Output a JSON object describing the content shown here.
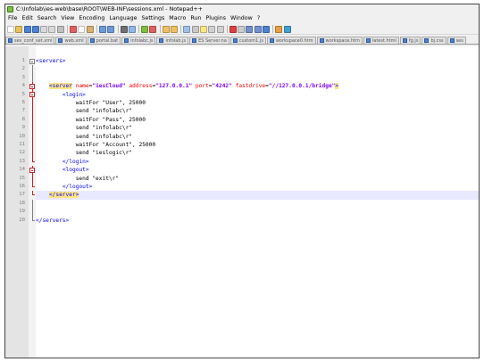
{
  "window": {
    "title": "C:\\Infolab\\ies-web\\base\\ROOT\\WEB-INF\\sessions.xml - Notepad++"
  },
  "menu": [
    "File",
    "Edit",
    "Search",
    "View",
    "Encoding",
    "Language",
    "Settings",
    "Macro",
    "Run",
    "Plugins",
    "Window",
    "?"
  ],
  "toolbar": {
    "buttons": [
      {
        "name": "new-file-icon",
        "color": "#ffffff"
      },
      {
        "name": "open-file-icon",
        "color": "#e8c25a"
      },
      {
        "name": "save-icon",
        "color": "#4a82d4"
      },
      {
        "name": "save-all-icon",
        "color": "#4a82d4"
      },
      {
        "name": "close-icon",
        "color": "#d9d9d9"
      },
      {
        "name": "close-all-icon",
        "color": "#d9d9d9"
      },
      {
        "name": "print-icon",
        "color": "#bfbfbf"
      },
      {
        "sep": true
      },
      {
        "name": "cut-icon",
        "color": "#e06060"
      },
      {
        "name": "copy-icon",
        "color": "#ffffff"
      },
      {
        "name": "paste-icon",
        "color": "#d8b070"
      },
      {
        "sep": true
      },
      {
        "name": "undo-icon",
        "color": "#6a9ad8"
      },
      {
        "name": "redo-icon",
        "color": "#6a9ad8"
      },
      {
        "sep": true
      },
      {
        "name": "find-icon",
        "color": "#707070"
      },
      {
        "name": "replace-icon",
        "color": "#8fb7e8"
      },
      {
        "sep": true
      },
      {
        "name": "zoom-in-icon",
        "color": "#7fbf3f"
      },
      {
        "name": "zoom-out-icon",
        "color": "#e06060"
      },
      {
        "sep": true
      },
      {
        "name": "sync-vertical-icon",
        "color": "#f0c060"
      },
      {
        "name": "sync-horizontal-icon",
        "color": "#f0c060"
      },
      {
        "sep": true
      },
      {
        "name": "word-wrap-icon",
        "color": "#9fc0e8"
      },
      {
        "name": "show-all-chars-icon",
        "color": "#c8c8c8"
      },
      {
        "name": "indent-guide-icon",
        "color": "#ffe680"
      },
      {
        "name": "doc-map-icon",
        "color": "#d0d0d0"
      },
      {
        "name": "function-list-icon",
        "color": "#d0d0d0"
      },
      {
        "sep": true
      },
      {
        "name": "record-macro-icon",
        "color": "#e04040"
      },
      {
        "name": "stop-record-icon",
        "color": "#cccccc"
      },
      {
        "name": "playback-icon",
        "color": "#7090d0"
      },
      {
        "name": "run-multiple-icon",
        "color": "#7090d0"
      },
      {
        "name": "save-macro-icon",
        "color": "#4a82d4"
      },
      {
        "sep": true
      },
      {
        "name": "spell-check-icon",
        "color": "#e8a040"
      },
      {
        "name": "plugin-icon",
        "color": "#40a0d0"
      }
    ]
  },
  "tabs": [
    "ses_conf_set.xml",
    "web.xml",
    "portal.bat",
    "infolabc.js",
    "infolab.js",
    "ES Server.na",
    "custom1.js",
    "workspace0.htm",
    "workspace.htm",
    "latest.html",
    "fg.js",
    "bj.css",
    "ses"
  ],
  "editor": {
    "line_numbers": [
      "1",
      "2",
      "3",
      "4",
      "5",
      "6",
      "7",
      "8",
      "9",
      "10",
      "11",
      "12",
      "13",
      "14",
      "15",
      "16",
      "17",
      "18",
      "19",
      "20"
    ],
    "lines": [
      {
        "segments": [
          {
            "t": "<servers>",
            "c": "tag"
          }
        ]
      },
      {
        "segments": []
      },
      {
        "segments": []
      },
      {
        "segments": [
          {
            "t": "    "
          },
          {
            "t": "<server",
            "c": "tag hl"
          },
          {
            "t": " ",
            "c": "plain"
          },
          {
            "t": "name",
            "c": "attr"
          },
          {
            "t": "=",
            "c": "plain"
          },
          {
            "t": "\"iesCloud\"",
            "c": "val"
          },
          {
            "t": " ",
            "c": "plain"
          },
          {
            "t": "address",
            "c": "attr"
          },
          {
            "t": "=",
            "c": "plain"
          },
          {
            "t": "\"127.0.0.1\"",
            "c": "val"
          },
          {
            "t": " ",
            "c": "plain"
          },
          {
            "t": "port",
            "c": "attr"
          },
          {
            "t": "=",
            "c": "plain"
          },
          {
            "t": "\"4242\"",
            "c": "val"
          },
          {
            "t": " ",
            "c": "plain"
          },
          {
            "t": "fastdrive",
            "c": "attr"
          },
          {
            "t": "=",
            "c": "plain"
          },
          {
            "t": "\"//127.0.0.1/bridge\"",
            "c": "val"
          },
          {
            "t": ">",
            "c": "tag hl"
          }
        ]
      },
      {
        "segments": [
          {
            "t": "        "
          },
          {
            "t": "<login>",
            "c": "tag"
          }
        ]
      },
      {
        "segments": [
          {
            "t": "            waitFor \"User\", 25000",
            "c": "plain"
          }
        ]
      },
      {
        "segments": [
          {
            "t": "            send \"infolabc\\r\"",
            "c": "plain"
          }
        ]
      },
      {
        "segments": [
          {
            "t": "            waitFor \"Pass\", 25000",
            "c": "plain"
          }
        ]
      },
      {
        "segments": [
          {
            "t": "            send \"infolabc\\r\"",
            "c": "plain"
          }
        ]
      },
      {
        "segments": [
          {
            "t": "            send \"infolabc\\r\"",
            "c": "plain"
          }
        ]
      },
      {
        "segments": [
          {
            "t": "            waitFor \"Account\", 25000",
            "c": "plain"
          }
        ]
      },
      {
        "segments": [
          {
            "t": "            send \"ieslogic\\r\"",
            "c": "plain"
          }
        ]
      },
      {
        "segments": [
          {
            "t": "        "
          },
          {
            "t": "</login>",
            "c": "tag"
          }
        ]
      },
      {
        "segments": [
          {
            "t": "        "
          },
          {
            "t": "<logout>",
            "c": "tag"
          }
        ]
      },
      {
        "segments": [
          {
            "t": "            send \"exit\\r\"",
            "c": "plain"
          }
        ]
      },
      {
        "segments": [
          {
            "t": "        "
          },
          {
            "t": "</logout>",
            "c": "tag"
          }
        ]
      },
      {
        "segments": [
          {
            "t": "    "
          },
          {
            "t": "</server>",
            "c": "tag hl"
          }
        ],
        "current": true
      },
      {
        "segments": []
      },
      {
        "segments": []
      },
      {
        "segments": [
          {
            "t": "</servers>",
            "c": "tag"
          }
        ]
      }
    ],
    "folds": [
      {
        "line": 1,
        "kind": "box"
      },
      {
        "line": 2,
        "kind": "vline"
      },
      {
        "line": 3,
        "kind": "vline"
      },
      {
        "line": 4,
        "kind": "box",
        "red": true
      },
      {
        "line": 5,
        "kind": "box",
        "red": true
      },
      {
        "line": 6,
        "kind": "vline",
        "red": true
      },
      {
        "line": 7,
        "kind": "vline",
        "red": true
      },
      {
        "line": 8,
        "kind": "vline",
        "red": true
      },
      {
        "line": 9,
        "kind": "vline",
        "red": true
      },
      {
        "line": 10,
        "kind": "vline",
        "red": true
      },
      {
        "line": 11,
        "kind": "vline",
        "red": true
      },
      {
        "line": 12,
        "kind": "vline",
        "red": true
      },
      {
        "line": 13,
        "kind": "end",
        "red": true
      },
      {
        "line": 14,
        "kind": "box",
        "red": true
      },
      {
        "line": 15,
        "kind": "vline",
        "red": true
      },
      {
        "line": 16,
        "kind": "end",
        "red": true
      },
      {
        "line": 17,
        "kind": "end",
        "red": true
      },
      {
        "line": 18,
        "kind": "vline"
      },
      {
        "line": 19,
        "kind": "vline"
      },
      {
        "line": 20,
        "kind": "end"
      }
    ]
  }
}
